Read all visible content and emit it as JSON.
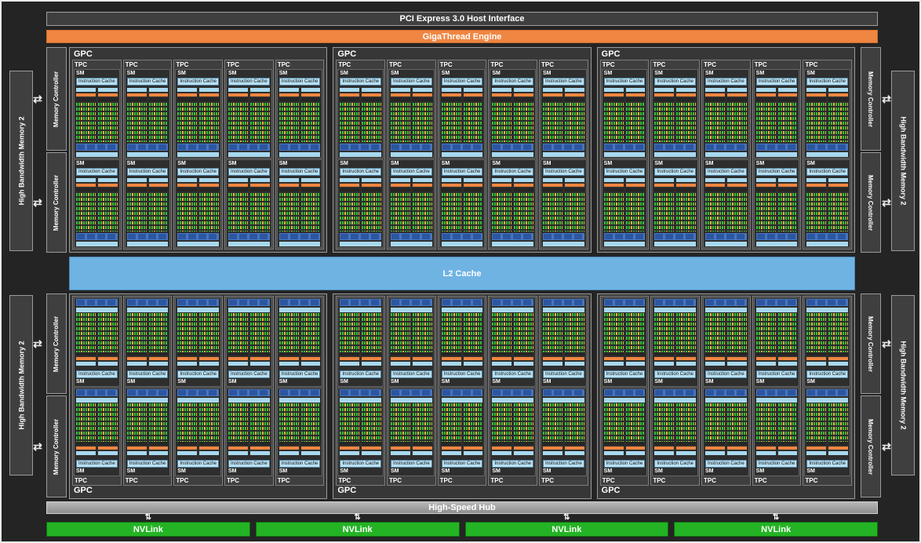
{
  "top_bars": {
    "pci": "PCI Express 3.0 Host Interface",
    "gigathread": "GigaThread Engine"
  },
  "block_labels": {
    "gpc": "GPC",
    "tpc": "TPC",
    "sm": "SM",
    "instruction_cache": "Instruction Cache"
  },
  "l2": {
    "label": "L2 Cache"
  },
  "memory": {
    "hbm_label": "High Bandwidth Memory 2",
    "mc_label": "Memory Controller",
    "hbm_module_count": 4,
    "memory_controller_count": 8
  },
  "bottom_bars": {
    "hub": "High-Speed Hub",
    "nvlink": "NVLink",
    "nvlink_count": 4
  },
  "structure": {
    "gpc_rows": 2,
    "gpcs_per_row": 3,
    "tpc_per_gpc": 5,
    "sm_per_tpc": 2,
    "blocks_per_sm": 2
  },
  "icons": {
    "exchange_arrow": "⇄",
    "updown_arrow": "⇅"
  },
  "colors": {
    "background": "#242424",
    "box_gray": "#3f3f3f",
    "orange_accent": "#ef8641",
    "light_blue": "#a8d8ee",
    "instruction_cache_blue": "#b9e0f2",
    "l2_blue": "#6fb3e3",
    "core_green": "#3bba3b",
    "core_orange": "#eeb23c",
    "tex_blue": "#4576be",
    "tex_segment_blue": "#2d55a0",
    "hub_gray": "#9d9d9d",
    "nvlink_green": "#24b324"
  }
}
